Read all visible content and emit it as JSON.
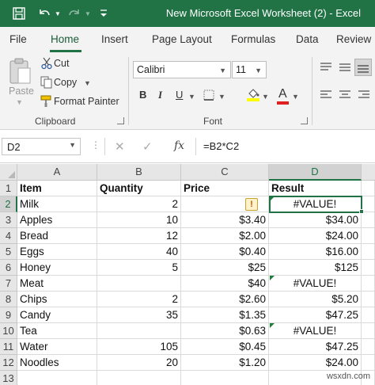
{
  "window": {
    "title": "New Microsoft Excel Worksheet (2)  -  Excel"
  },
  "quick_access": [
    "save-icon",
    "undo-icon",
    "redo-icon",
    "customize-icon"
  ],
  "ribbon_tabs": [
    {
      "label": "File"
    },
    {
      "label": "Home",
      "active": true
    },
    {
      "label": "Insert"
    },
    {
      "label": "Page Layout"
    },
    {
      "label": "Formulas"
    },
    {
      "label": "Data"
    },
    {
      "label": "Review"
    }
  ],
  "clipboard": {
    "paste": "Paste",
    "cut": "Cut",
    "copy": "Copy",
    "format_painter": "Format Painter",
    "group_label": "Clipboard"
  },
  "font": {
    "name": "Calibri",
    "size": "11",
    "bold": "B",
    "italic": "I",
    "underline": "U",
    "font_color_glyph": "A",
    "group_label": "Font",
    "fill_color": "#ffff00",
    "font_color": "#e02020"
  },
  "formula_bar": {
    "name_box": "D2",
    "cancel_glyph": "✕",
    "enter_glyph": "✓",
    "fx": "fx",
    "formula": "=B2*C2"
  },
  "columns": [
    "A",
    "B",
    "C",
    "D"
  ],
  "selected_column": "D",
  "selected_row": 2,
  "rows": [
    {
      "n": "1",
      "cells": [
        "Item",
        "Quantity",
        "Price",
        "Result"
      ]
    },
    {
      "n": "2",
      "cells": [
        "Milk",
        "2",
        "",
        "#VALUE!"
      ]
    },
    {
      "n": "3",
      "cells": [
        "Apples",
        "10",
        "$3.40",
        "$34.00"
      ]
    },
    {
      "n": "4",
      "cells": [
        "Bread",
        "12",
        "$2.00",
        "$24.00"
      ]
    },
    {
      "n": "5",
      "cells": [
        "Eggs",
        "40",
        "$0.40",
        "$16.00"
      ]
    },
    {
      "n": "6",
      "cells": [
        "Honey",
        "5",
        "$25",
        "$125"
      ]
    },
    {
      "n": "7",
      "cells": [
        "Meat",
        "",
        "$40",
        "#VALUE!"
      ]
    },
    {
      "n": "8",
      "cells": [
        "Chips",
        "2",
        "$2.60",
        "$5.20"
      ]
    },
    {
      "n": "9",
      "cells": [
        "Candy",
        "35",
        "$1.35",
        "$47.25"
      ]
    },
    {
      "n": "10",
      "cells": [
        "Tea",
        "",
        "$0.63",
        "#VALUE!"
      ]
    },
    {
      "n": "11",
      "cells": [
        "Water",
        "105",
        "$0.45",
        "$47.25"
      ]
    },
    {
      "n": "12",
      "cells": [
        "Noodles",
        "20",
        "$1.20",
        "$24.00"
      ]
    },
    {
      "n": "13",
      "cells": [
        "",
        "",
        "",
        ""
      ]
    }
  ],
  "warning_glyph": "!",
  "watermark": "wsxdn.com",
  "colors": {
    "accent": "#217346",
    "error_triangle": "#1d7d3a"
  }
}
